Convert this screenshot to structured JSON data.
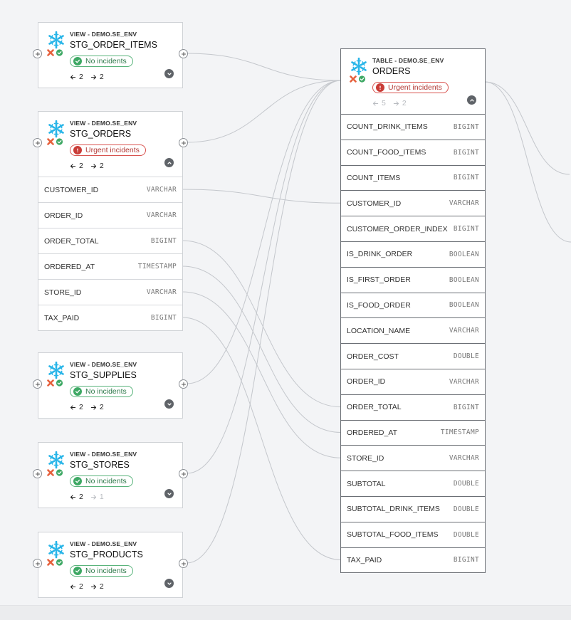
{
  "colors": {
    "ok": "#3ea864",
    "urgent": "#c93c37",
    "edge": "#c4c7cc"
  },
  "nodes": [
    {
      "id": "stg_order_items",
      "kind": "VIEW - DEMO.SE_ENV",
      "name": "STG_ORDER_ITEMS",
      "status": "No incidents",
      "status_type": "ok",
      "upstream": "2",
      "downstream": "2",
      "expanded": false
    },
    {
      "id": "stg_orders",
      "kind": "VIEW - DEMO.SE_ENV",
      "name": "STG_ORDERS",
      "status": "Urgent incidents",
      "status_type": "bad",
      "upstream": "2",
      "downstream": "2",
      "expanded": true,
      "columns": [
        {
          "name": "CUSTOMER_ID",
          "type": "VARCHAR"
        },
        {
          "name": "ORDER_ID",
          "type": "VARCHAR"
        },
        {
          "name": "ORDER_TOTAL",
          "type": "BIGINT"
        },
        {
          "name": "ORDERED_AT",
          "type": "TIMESTAMP"
        },
        {
          "name": "STORE_ID",
          "type": "VARCHAR"
        },
        {
          "name": "TAX_PAID",
          "type": "BIGINT"
        }
      ]
    },
    {
      "id": "stg_supplies",
      "kind": "VIEW - DEMO.SE_ENV",
      "name": "STG_SUPPLIES",
      "status": "No incidents",
      "status_type": "ok",
      "upstream": "2",
      "downstream": "2",
      "expanded": false
    },
    {
      "id": "stg_stores",
      "kind": "VIEW - DEMO.SE_ENV",
      "name": "STG_STORES",
      "status": "No incidents",
      "status_type": "ok",
      "upstream": "2",
      "downstream": "1",
      "downstream_dim": true,
      "expanded": false
    },
    {
      "id": "stg_products",
      "kind": "VIEW - DEMO.SE_ENV",
      "name": "STG_PRODUCTS",
      "status": "No incidents",
      "status_type": "ok",
      "upstream": "2",
      "downstream": "2",
      "expanded": false
    }
  ],
  "table": {
    "kind": "TABLE - DEMO.SE_ENV",
    "name": "ORDERS",
    "status": "Urgent incidents",
    "status_type": "bad",
    "upstream": "5",
    "downstream": "2",
    "counts_dim": true,
    "columns": [
      {
        "name": "COUNT_DRINK_ITEMS",
        "type": "BIGINT"
      },
      {
        "name": "COUNT_FOOD_ITEMS",
        "type": "BIGINT"
      },
      {
        "name": "COUNT_ITEMS",
        "type": "BIGINT"
      },
      {
        "name": "CUSTOMER_ID",
        "type": "VARCHAR"
      },
      {
        "name": "CUSTOMER_ORDER_INDEX",
        "type": "BIGINT"
      },
      {
        "name": "IS_DRINK_ORDER",
        "type": "BOOLEAN"
      },
      {
        "name": "IS_FIRST_ORDER",
        "type": "BOOLEAN"
      },
      {
        "name": "IS_FOOD_ORDER",
        "type": "BOOLEAN"
      },
      {
        "name": "LOCATION_NAME",
        "type": "VARCHAR"
      },
      {
        "name": "ORDER_COST",
        "type": "DOUBLE"
      },
      {
        "name": "ORDER_ID",
        "type": "VARCHAR"
      },
      {
        "name": "ORDER_TOTAL",
        "type": "BIGINT"
      },
      {
        "name": "ORDERED_AT",
        "type": "TIMESTAMP"
      },
      {
        "name": "STORE_ID",
        "type": "VARCHAR"
      },
      {
        "name": "SUBTOTAL",
        "type": "DOUBLE"
      },
      {
        "name": "SUBTOTAL_DRINK_ITEMS",
        "type": "DOUBLE"
      },
      {
        "name": "SUBTOTAL_FOOD_ITEMS",
        "type": "DOUBLE"
      },
      {
        "name": "TAX_PAID",
        "type": "BIGINT"
      }
    ]
  },
  "column_links": [
    [
      "CUSTOMER_ID",
      "CUSTOMER_ID"
    ],
    [
      "ORDER_TOTAL",
      "ORDER_TOTAL"
    ],
    [
      "ORDERED_AT",
      "ORDERED_AT"
    ],
    [
      "STORE_ID",
      "STORE_ID"
    ],
    [
      "TAX_PAID",
      "TAX_PAID"
    ]
  ]
}
